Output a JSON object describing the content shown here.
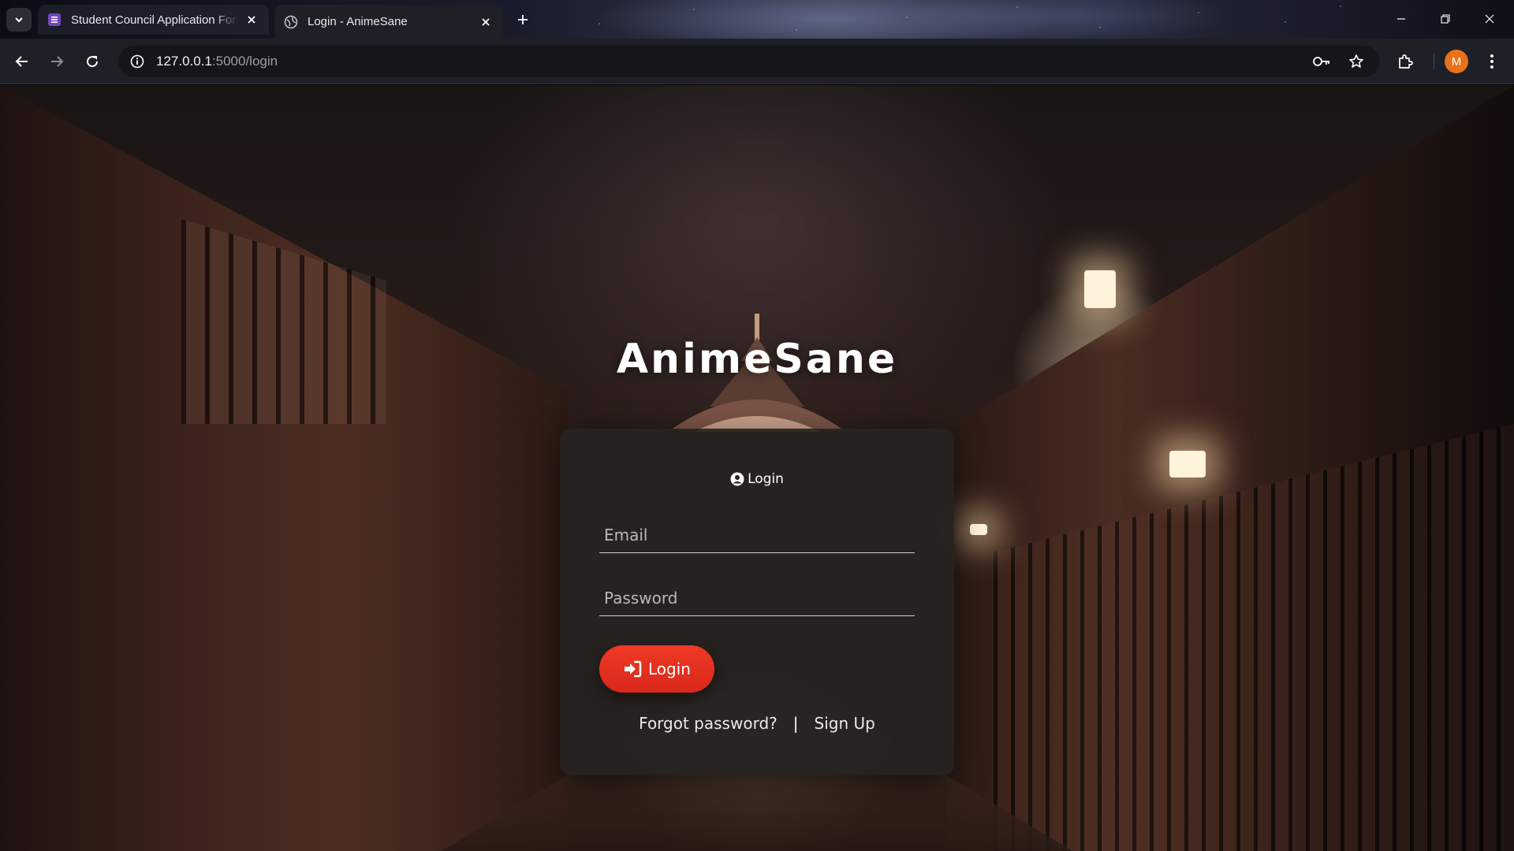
{
  "browser": {
    "tabs": [
      {
        "title": "Student Council Application Form",
        "active": false,
        "favicon": "forms-icon"
      },
      {
        "title": "Login - AnimeSane",
        "active": true,
        "favicon": "globe-icon"
      }
    ],
    "url": {
      "host": "127.0.0.1",
      "path": ":5000/login"
    },
    "profile_initial": "M",
    "accent_color": "#e8711a"
  },
  "page": {
    "brand": "AnimeSane",
    "card": {
      "title": "Login",
      "email_placeholder": "Email",
      "password_placeholder": "Password",
      "login_button": "Login",
      "forgot_password": "Forgot password?",
      "separator": "|",
      "sign_up": "Sign Up"
    },
    "button_color": "#e8311f"
  }
}
